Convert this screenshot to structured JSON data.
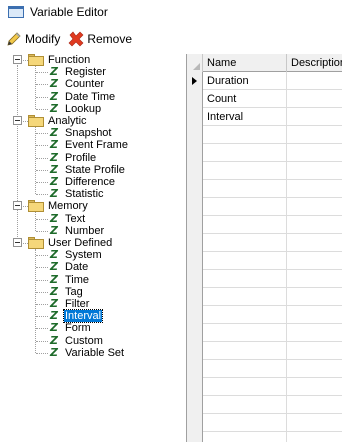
{
  "window": {
    "title": "Variable Editor",
    "icon": "window-icon"
  },
  "toolbar": {
    "modify_label": "Modify",
    "remove_label": "Remove"
  },
  "tree": {
    "groups": [
      {
        "label": "Function",
        "items": [
          "Register",
          "Counter",
          "Date Time",
          "Lookup"
        ]
      },
      {
        "label": "Analytic",
        "items": [
          "Snapshot",
          "Event Frame",
          "Profile",
          "State Profile",
          "Difference",
          "Statistic"
        ]
      },
      {
        "label": "Memory",
        "items": [
          "Text",
          "Number"
        ]
      },
      {
        "label": "User Defined",
        "items": [
          "System",
          "Date",
          "Time",
          "Tag",
          "Filter",
          "Interval",
          "Form",
          "Custom",
          "Variable Set"
        ]
      }
    ],
    "selected": "Interval"
  },
  "grid": {
    "columns": [
      "Name",
      "Description"
    ],
    "rows": [
      {
        "name": "Duration",
        "description": ""
      },
      {
        "name": "Count",
        "description": ""
      },
      {
        "name": "Interval",
        "description": ""
      }
    ]
  },
  "colors": {
    "selection": "#0078d7",
    "folder": "#f5d77a",
    "variable_icon": "#1e6b2a",
    "remove_icon": "#e03a20"
  }
}
